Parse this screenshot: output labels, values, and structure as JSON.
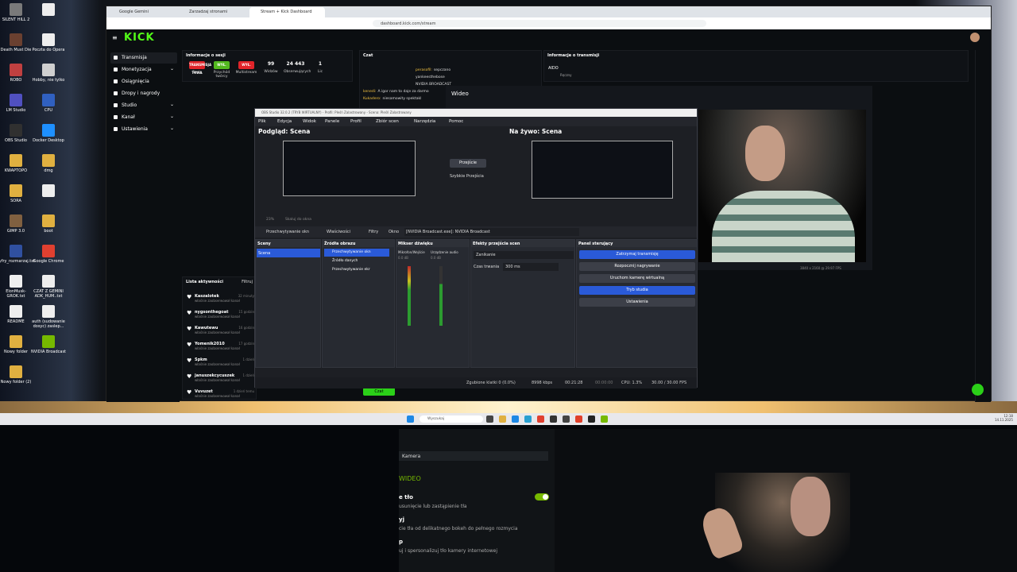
{
  "desktop": {
    "icons": [
      {
        "label": "SILENT HILL 2",
        "color": "#7a7a7a"
      },
      {
        "label": "Death Must Die",
        "color": "#6a4030"
      },
      {
        "label": "ROBO",
        "color": "#c04040"
      },
      {
        "label": "LM Studio",
        "color": "#5050c0"
      },
      {
        "label": "OBS Studio",
        "color": "#303030"
      },
      {
        "label": "KWAPTOPO",
        "color": "#e0b040"
      },
      {
        "label": "SORA",
        "color": "#e0b040"
      },
      {
        "label": "GIMP 3.0",
        "color": "#806040"
      },
      {
        "label": "cyfry_rozmarzaj.txt",
        "color": "#3050a0"
      },
      {
        "label": "ElonMusk-GROK.txt",
        "color": "#eeeeee"
      },
      {
        "label": "README",
        "color": "#eeeeee"
      },
      {
        "label": "Nowy folder",
        "color": "#e0b040"
      },
      {
        "label": "Nowy folder (2)",
        "color": "#e0b040"
      }
    ],
    "icons_col2": [
      {
        "label": "",
        "color": "#eeeeee"
      },
      {
        "label": "Poczta do Opera",
        "color": "#eeeeee"
      },
      {
        "label": "Hobby, nie tylko",
        "color": "#cfcfcf"
      },
      {
        "label": "CPU",
        "color": "#3060c0"
      },
      {
        "label": "Docker Desktop",
        "color": "#1e90ff"
      },
      {
        "label": "dmg",
        "color": "#e0b040"
      },
      {
        "label": "",
        "color": "#eeeeee"
      },
      {
        "label": "boot",
        "color": "#e0b040"
      },
      {
        "label": "Google Chrome",
        "color": "#e04030"
      },
      {
        "label": "CZAT Z GEMINI ADK_HUM..txt",
        "color": "#eeeeee"
      },
      {
        "label": "auth (sudowanie dosyc) zaslep...",
        "color": "#eeeeee"
      },
      {
        "label": "NVIDIA Broadcast",
        "color": "#76b900"
      }
    ]
  },
  "browser": {
    "tabs": [
      "Google Gemini",
      "Zarzadzaj stronami",
      "Stream + Kick Dashboard"
    ],
    "url": "dashboard.kick.com/stream"
  },
  "kick": {
    "logo": "KICK",
    "nav": [
      {
        "label": "Transmisja",
        "selected": true
      },
      {
        "label": "Monetyzacja",
        "selected": false,
        "expand": true
      },
      {
        "label": "Osiągnięcia",
        "selected": false
      },
      {
        "label": "Dropy i nagrody",
        "selected": false
      },
      {
        "label": "Studio",
        "selected": false,
        "expand": true
      },
      {
        "label": "Kanał",
        "selected": false,
        "expand": true
      },
      {
        "label": "Ustawienia",
        "selected": false,
        "expand": true
      }
    ],
    "session": {
      "title": "Informacje o sesji",
      "stats": [
        {
          "badge": "TRANSMISJA TRWA",
          "label": "Sesja",
          "color": "#e0242a",
          "value": ""
        },
        {
          "badge": "WYŁ.",
          "label": "Przychód twórcy",
          "color": "#53b91f",
          "value": ""
        },
        {
          "badge": "WYŁ.",
          "label": "Multistream",
          "color": "#e0242a",
          "value": ""
        },
        {
          "badge": "",
          "label": "Widzów",
          "color": "",
          "value": "99"
        },
        {
          "badge": "",
          "label": "Obserwujących",
          "color": "",
          "value": "24 443"
        },
        {
          "badge": "",
          "label": "Lic",
          "color": "",
          "value": "1"
        }
      ]
    },
    "chat": {
      "title": "Czat",
      "messages": [
        {
          "user": "perasofil",
          "text": "sepczano"
        },
        {
          "user": "",
          "text": "yankeesthebose"
        },
        {
          "user": "",
          "text": "NVIDIA BROADCAST"
        },
        {
          "user": "kenedi",
          "text": "A igor nam to daje za darmo"
        },
        {
          "user": "Kukadero",
          "text": "niesamowity spektakl"
        }
      ]
    },
    "stream_info": {
      "title": "Informacje o transmisji",
      "game": "AIDO",
      "sub": "Ręczny"
    },
    "activity": {
      "title": "Lista aktywności",
      "filter": "Filtruj",
      "items": [
        {
          "user": "Kaszalotek",
          "desc": "właśnie zaobserwował kanał",
          "time": "32 minuty"
        },
        {
          "user": "nygsonthegoat",
          "desc": "właśnie zaobserwował kanał",
          "time": "15 godzin"
        },
        {
          "user": "Kawutewu",
          "desc": "właśnie zaobserwował kanał",
          "time": "16 godzin"
        },
        {
          "user": "Yomenik2010",
          "desc": "właśnie zaobserwował kanał",
          "time": "17 godzin"
        },
        {
          "user": "Spkm",
          "desc": "właśnie zaobserwował kanał",
          "time": "1 dzień"
        },
        {
          "user": "januszekcycuszek",
          "desc": "właśnie zaobserwował kanał",
          "time": "1 dzień"
        },
        {
          "user": "Vuvuzet",
          "desc": "właśnie zaobserwował kanał",
          "time": "1 dzień temu"
        }
      ]
    },
    "video_title": "Wideo",
    "chat_button": "Czat",
    "video_meta": "3840 x 2160 @ 29.97 FPS"
  },
  "obs": {
    "titlebar": "OBS Studio 32.0.2 (TRYB WIRTUALNY) - Profil: Pleśń Zalastrowany - Scena: Pleśń Zalastrowany",
    "menu": [
      "Plik",
      "Edycja",
      "Widok",
      "Panele",
      "Profil",
      "Zbiór scen",
      "Narzędzia",
      "Pomoc"
    ],
    "preview_title": "Podgląd: Scena",
    "live_title": "Na żywo: Scena",
    "transition_btn": "Przejście",
    "quick_transitions": "Szybkie Przejścia",
    "zoom": "23%",
    "scale_label": "Skaluj do okna",
    "source_bar": {
      "capture": "Przechwytywanie okn",
      "props": "Właściwości",
      "filters": "Filtry",
      "window_label": "Okno",
      "window_value": "[NVIDIA Broadcast.exe]: NVIDIA Broadcast"
    },
    "docks": {
      "scenes": {
        "title": "Sceny",
        "items": [
          "Scena"
        ]
      },
      "sources": {
        "title": "Źródła obrazu",
        "items": [
          "Przechwytywanie okn",
          "Źródło danych",
          "Przechwytywanie ekr"
        ]
      },
      "mixer": {
        "title": "Mikser dźwięku",
        "ch1": "Mikrofon/Wejście",
        "ch2": "Urządzenie audio",
        "ch1_db": "0.0 dB",
        "ch2_db": "0.0 dB"
      },
      "transitions": {
        "title": "Efekty przejścia scen",
        "effect": "Zanikanie",
        "duration_label": "Czas trwania",
        "duration": "300 ms"
      },
      "controls": {
        "title": "Panel sterujący",
        "buttons": [
          {
            "label": "Zatrzymaj transmisję",
            "blue": true
          },
          {
            "label": "Rozpocznij nagrywanie",
            "blue": false
          },
          {
            "label": "Uruchom kamerę wirtualną",
            "blue": false
          },
          {
            "label": "Tryb studia",
            "blue": true
          },
          {
            "label": "Ustawienia",
            "blue": false
          }
        ]
      }
    },
    "status": {
      "dropped": "Zgubione klatki 0 (0.0%)",
      "kbps": "8998 kbps",
      "live_time": "00:21:28",
      "rec_time": "00:00:00",
      "cpu": "CPU: 1.3%",
      "fps": "30.00 / 30.00 FPS"
    }
  },
  "taskbar": {
    "search_placeholder": "Wyszukaj",
    "time": "12:18",
    "date": "14.11.2025"
  },
  "nvidia": {
    "dropdown": "Kamera",
    "section": "WIDEO",
    "items": [
      {
        "title": "e tło",
        "desc": "usunięcie lub zastąpienie tła"
      },
      {
        "title": "yj",
        "desc": "cie tła od delikatnego bokeh do pełnego rozmycia"
      },
      {
        "title": "p",
        "desc": "uj i spersonalizuj tło kamery internetowej"
      }
    ]
  }
}
